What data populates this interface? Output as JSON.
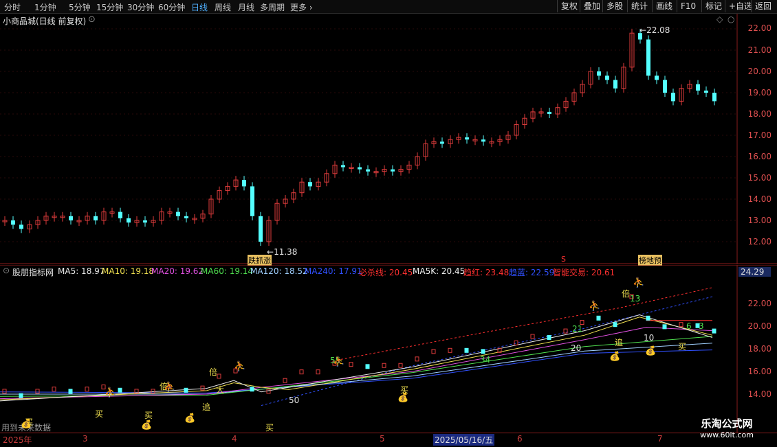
{
  "toolbar": {
    "periods": [
      "分时",
      "1分钟",
      "5分钟",
      "15分钟",
      "30分钟",
      "60分钟",
      "日线",
      "周线",
      "月线",
      "多周期",
      "更多"
    ],
    "active_period": "日线",
    "more_arrow": "chevron-right-icon",
    "right_buttons": [
      "复权",
      "叠加",
      "多股",
      "统计",
      "画线",
      "F10",
      "+自选",
      "返回"
    ]
  },
  "main": {
    "title": "小商品城(日线 前复权)",
    "dropdown_icon": "chevron-down-circle-icon",
    "corner_icons": [
      "diamond-icon",
      "circle-icon"
    ],
    "y_ticks": [
      "22.00",
      "21.00",
      "20.00",
      "19.00",
      "18.00",
      "17.00",
      "16.00",
      "15.00",
      "14.00",
      "13.00",
      "12.00"
    ],
    "high_label": "22.08",
    "low_label": "11.38",
    "tag_left": "跌抓涨",
    "tag_right": "榜地预",
    "tag_mid": "S"
  },
  "sub": {
    "title": "股朋指标网",
    "ma_labels": [
      {
        "text": "MA5: 18.97",
        "color": "#e8e8e8"
      },
      {
        "text": "MA10: 19.18",
        "color": "#f0e050"
      },
      {
        "text": "MA20: 19.62",
        "color": "#e050e0"
      },
      {
        "text": "MA60: 19.14",
        "color": "#50e050"
      },
      {
        "text": "MA120: 18.52",
        "color": "#a0d0ff"
      },
      {
        "text": "MA240: 17.91",
        "color": "#3050ff"
      },
      {
        "text": "必杀线: 20.45",
        "color": "#ff3030"
      },
      {
        "text": "MA5K: 20.45",
        "color": "#f0f0f0"
      },
      {
        "text": "趋红: 23.48",
        "color": "#ff3030"
      },
      {
        "text": "趋蓝: 22.59",
        "color": "#3050ff"
      },
      {
        "text": "智能交易: 20.61",
        "color": "#ff3030"
      }
    ],
    "y_ticks": [
      "22.00",
      "20.00",
      "18.00",
      "16.00",
      "14.00"
    ],
    "current_value": "24.29",
    "bottom_left_text": "用到未来数据",
    "labels": {
      "bei": "倍",
      "mai": "买",
      "zhui": "追",
      "da": "大",
      "n13": "13",
      "n21": "21",
      "n20": "20",
      "n10": "10",
      "n6": "6",
      "n3": "3",
      "n34": "34",
      "n55": "55",
      "n50": "50"
    }
  },
  "date_axis": {
    "labels": [
      "2025年",
      "3",
      "4",
      "5",
      "6",
      "7"
    ],
    "selected_date": "2025/05/16/五"
  },
  "watermark": {
    "title": "乐淘公式网",
    "url": "www.60lt.com"
  },
  "colors": {
    "up": "#e03c3c",
    "down": "#54ffff",
    "axis": "#8a1c1c",
    "active": "#4fb0ff"
  }
}
